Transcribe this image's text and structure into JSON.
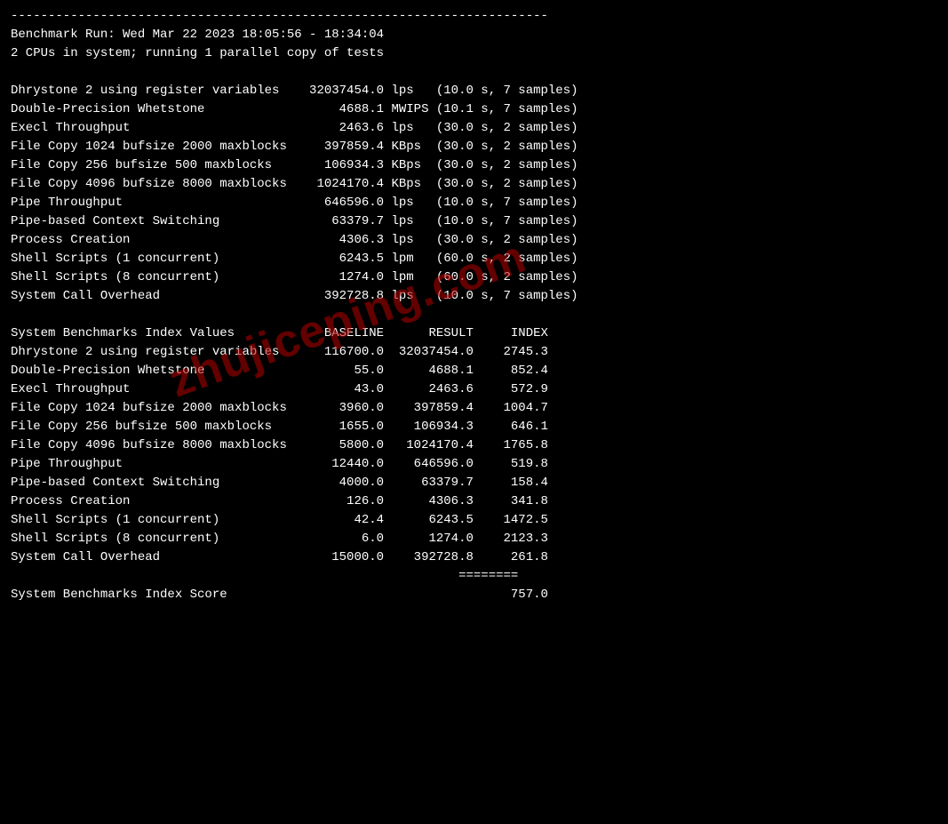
{
  "separator": "------------------------------------------------------------------------",
  "header": {
    "line1": "Benchmark Run: Wed Mar 22 2023 18:05:56 - 18:34:04",
    "line2": "2 CPUs in system; running 1 parallel copy of tests"
  },
  "benchmarks": [
    {
      "name": "Dhrystone 2 using register variables",
      "value": "32037454.0",
      "unit": "lps",
      "detail": "(10.0 s, 7 samples)"
    },
    {
      "name": "Double-Precision Whetstone",
      "value": "4688.1",
      "unit": "MWIPS",
      "detail": "(10.1 s, 7 samples)"
    },
    {
      "name": "Execl Throughput",
      "value": "2463.6",
      "unit": "lps",
      "detail": "(30.0 s, 2 samples)"
    },
    {
      "name": "File Copy 1024 bufsize 2000 maxblocks",
      "value": "397859.4",
      "unit": "KBps",
      "detail": "(30.0 s, 2 samples)"
    },
    {
      "name": "File Copy 256 bufsize 500 maxblocks",
      "value": "106934.3",
      "unit": "KBps",
      "detail": "(30.0 s, 2 samples)"
    },
    {
      "name": "File Copy 4096 bufsize 8000 maxblocks",
      "value": "1024170.4",
      "unit": "KBps",
      "detail": "(30.0 s, 2 samples)"
    },
    {
      "name": "Pipe Throughput",
      "value": "646596.0",
      "unit": "lps",
      "detail": "(10.0 s, 7 samples)"
    },
    {
      "name": "Pipe-based Context Switching",
      "value": "63379.7",
      "unit": "lps",
      "detail": "(10.0 s, 7 samples)"
    },
    {
      "name": "Process Creation",
      "value": "4306.3",
      "unit": "lps",
      "detail": "(30.0 s, 2 samples)"
    },
    {
      "name": "Shell Scripts (1 concurrent)",
      "value": "6243.5",
      "unit": "lpm",
      "detail": "(60.0 s, 2 samples)"
    },
    {
      "name": "Shell Scripts (8 concurrent)",
      "value": "1274.0",
      "unit": "lpm",
      "detail": "(60.0 s, 2 samples)"
    },
    {
      "name": "System Call Overhead",
      "value": "392728.8",
      "unit": "lps",
      "detail": "(10.0 s, 7 samples)"
    }
  ],
  "index_table": {
    "header": {
      "label": "System Benchmarks Index Values",
      "col1": "BASELINE",
      "col2": "RESULT",
      "col3": "INDEX"
    },
    "rows": [
      {
        "name": "Dhrystone 2 using register variables",
        "baseline": "116700.0",
        "result": "32037454.0",
        "index": "2745.3"
      },
      {
        "name": "Double-Precision Whetstone",
        "baseline": "55.0",
        "result": "4688.1",
        "index": "852.4"
      },
      {
        "name": "Execl Throughput",
        "baseline": "43.0",
        "result": "2463.6",
        "index": "572.9"
      },
      {
        "name": "File Copy 1024 bufsize 2000 maxblocks",
        "baseline": "3960.0",
        "result": "397859.4",
        "index": "1004.7"
      },
      {
        "name": "File Copy 256 bufsize 500 maxblocks",
        "baseline": "1655.0",
        "result": "106934.3",
        "index": "646.1"
      },
      {
        "name": "File Copy 4096 bufsize 8000 maxblocks",
        "baseline": "5800.0",
        "result": "1024170.4",
        "index": "1765.8"
      },
      {
        "name": "Pipe Throughput",
        "baseline": "12440.0",
        "result": "646596.0",
        "index": "519.8"
      },
      {
        "name": "Pipe-based Context Switching",
        "baseline": "4000.0",
        "result": "63379.7",
        "index": "158.4"
      },
      {
        "name": "Process Creation",
        "baseline": "126.0",
        "result": "4306.3",
        "index": "341.8"
      },
      {
        "name": "Shell Scripts (1 concurrent)",
        "baseline": "42.4",
        "result": "6243.5",
        "index": "1472.5"
      },
      {
        "name": "Shell Scripts (8 concurrent)",
        "baseline": "6.0",
        "result": "1274.0",
        "index": "2123.3"
      },
      {
        "name": "System Call Overhead",
        "baseline": "15000.0",
        "result": "392728.8",
        "index": "261.8"
      }
    ],
    "equals": "========",
    "score_label": "System Benchmarks Index Score",
    "score_value": "757.0"
  },
  "watermark": "zhujiceping.com"
}
